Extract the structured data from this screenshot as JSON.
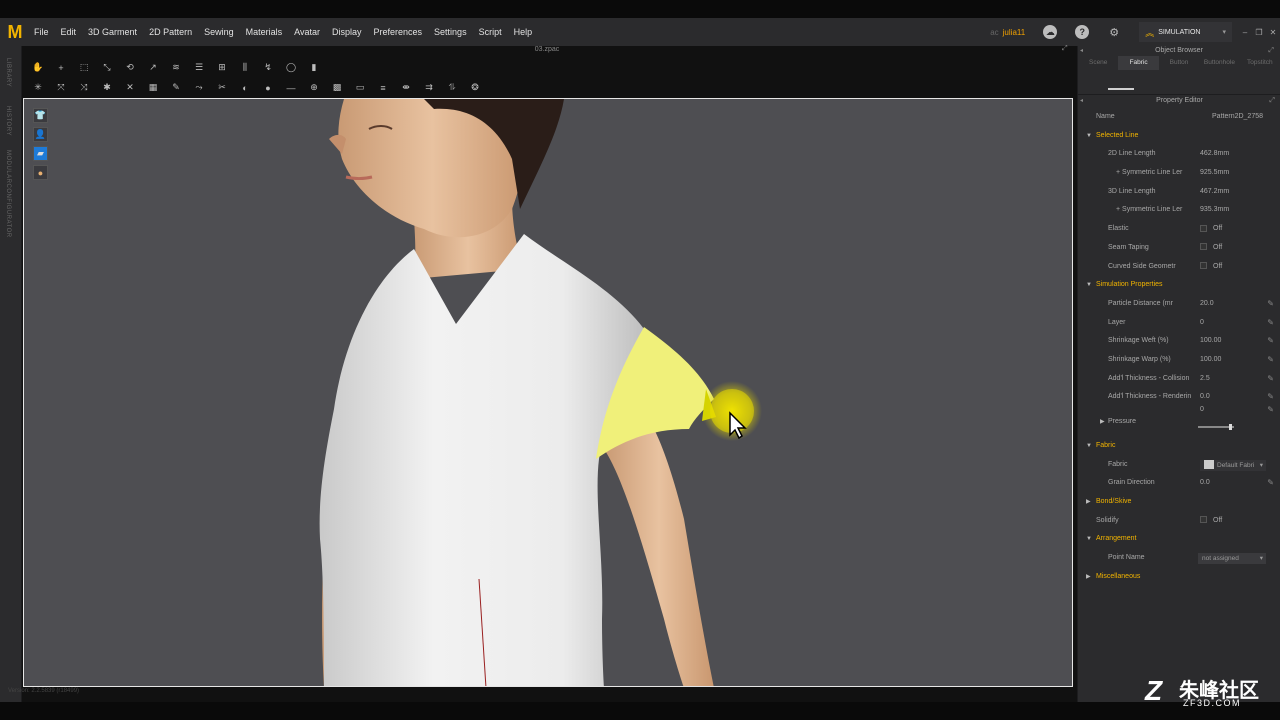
{
  "app": {
    "logo_letter": "M",
    "document_title": "03.zpac"
  },
  "menu": [
    "File",
    "Edit",
    "3D Garment",
    "2D Pattern",
    "Sewing",
    "Materials",
    "Avatar",
    "Display",
    "Preferences",
    "Settings",
    "Script",
    "Help"
  ],
  "header_right": {
    "user_prefix": "ac",
    "user_name": "julia11",
    "help_glyph": "?",
    "mode": "SIMULATION"
  },
  "left_tabs": [
    "LIBRARY",
    "HISTORY",
    "MODULARCONFIGURATOR"
  ],
  "viewport": {
    "status_text": "Version: 2.2.5839 (r18499)"
  },
  "object_browser": {
    "title": "Object Browser",
    "tabs": [
      "Scene",
      "Fabric",
      "Button",
      "Buttonhole",
      "Topstitch"
    ],
    "active_tab": "Fabric"
  },
  "property_editor": {
    "title": "Property Editor",
    "name_label": "Name",
    "name_value": "Pattern2D_2758",
    "selected_line": {
      "title": "Selected Line",
      "length_2d_label": "2D Line Length",
      "length_2d_value": "462.8mm",
      "sym_2d_label": "+ Symmetric Line Ler",
      "sym_2d_value": "925.5mm",
      "length_3d_label": "3D Line Length",
      "length_3d_value": "467.2mm",
      "sym_3d_label": "+ Symmetric Line Ler",
      "sym_3d_value": "935.3mm",
      "elastic_label": "Elastic",
      "elastic_value": "Off",
      "seam_taping_label": "Seam Taping",
      "seam_taping_value": "Off",
      "curved_label": "Curved Side Geometr",
      "curved_value": "Off"
    },
    "simulation": {
      "title": "Simulation Properties",
      "particle_label": "Particle Distance (mr",
      "particle_value": "20.0",
      "layer_label": "Layer",
      "layer_value": "0",
      "weft_label": "Shrinkage Weft (%)",
      "weft_value": "100.00",
      "warp_label": "Shrinkage Warp (%)",
      "warp_value": "100.00",
      "collision_label": "Add'l Thickness - Collision",
      "collision_value": "2.5",
      "rendering_label": "Add'l Thickness - Renderin",
      "rendering_value": "0.0",
      "pressure_label": "Pressure",
      "pressure_value": "0",
      "pressure_level": 0.9
    },
    "fabric": {
      "title": "Fabric",
      "fabric_label": "Fabric",
      "fabric_value": "Default Fabri",
      "grain_label": "Grain Direction",
      "grain_value": "0.0"
    },
    "bond_skive": {
      "title": "Bond/Skive"
    },
    "solidify": {
      "label": "Solidify",
      "value": "Off"
    },
    "arrangement": {
      "title": "Arrangement",
      "point_label": "Point Name",
      "point_value": "not assigned"
    },
    "misc": {
      "title": "Miscellaneous"
    }
  },
  "watermark": {
    "text": "朱峰社区",
    "url": "ZF3D.COM"
  },
  "colors": {
    "accent": "#f2b400",
    "highlight": "#f0f07a",
    "viewport_bg": "#4e4e52",
    "panel_bg": "#2b2b2d"
  }
}
